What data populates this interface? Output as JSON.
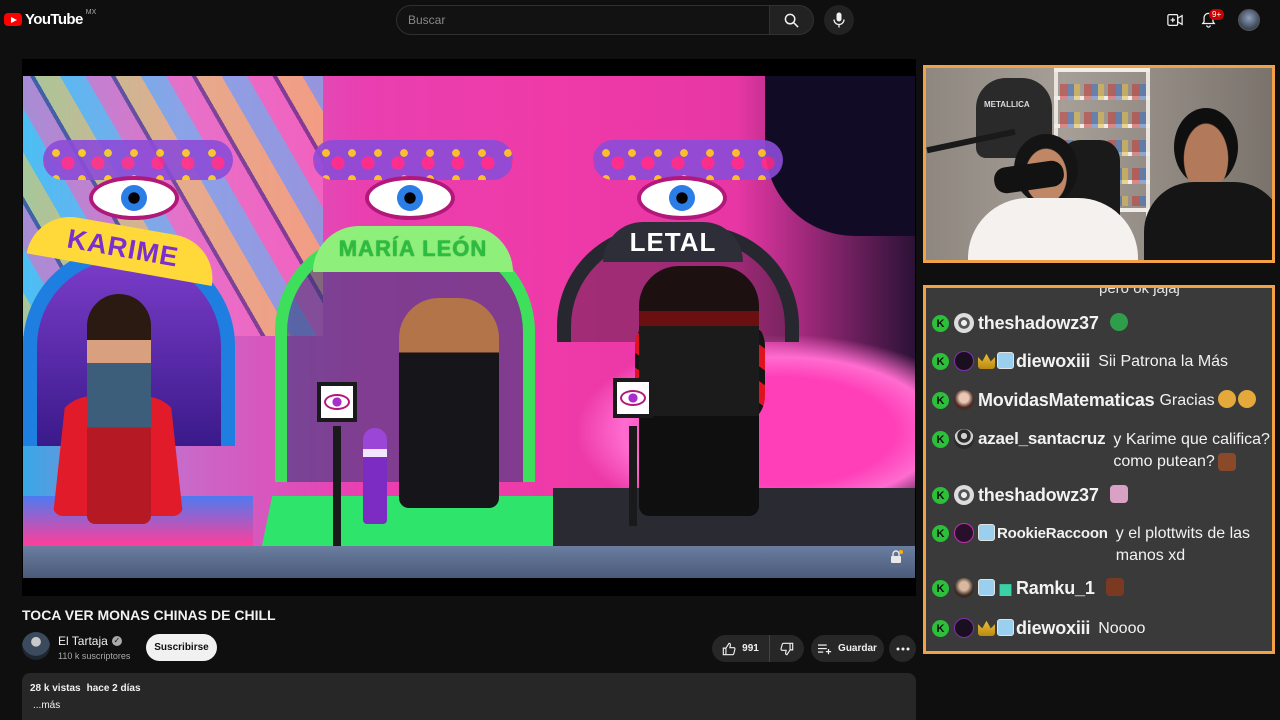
{
  "header": {
    "logo_text": "YouTube",
    "country_code": "MX",
    "search_placeholder": "Buscar",
    "notification_count": "9+"
  },
  "video": {
    "title": "TOCA VER MONAS CHINAS DE CHILL",
    "scene_labels": [
      "KARIME",
      "MARÍA LEÓN",
      "LETAL"
    ]
  },
  "channel": {
    "name": "El Tartaja",
    "subscribers": "110 k suscriptores",
    "subscribe_label": "Suscribirse"
  },
  "actions": {
    "like_count": "991",
    "save_label": "Guardar"
  },
  "description": {
    "views": "28 k vistas",
    "date": "hace 2 días",
    "more_label": "...más"
  },
  "webcam": {
    "jacket_text": "METALLICA"
  },
  "chat": {
    "cut_off_text": "pero ok jajaj",
    "messages": [
      {
        "user": "theshadowz37",
        "text": ""
      },
      {
        "user": "diewoxiii",
        "text": "Sii Patrona la Más"
      },
      {
        "user": "MovidasMatematicas",
        "text": "Gracias"
      },
      {
        "user": "azael_santacruz",
        "text": "y Karime que califica? como putean?"
      },
      {
        "user": "theshadowz37",
        "text": ""
      },
      {
        "user": "RookieRaccoon",
        "text": "y el plottwits de las manos xd"
      },
      {
        "user": "Ramku_1",
        "text": ""
      },
      {
        "user": "diewoxiii",
        "text": "Noooo"
      }
    ]
  },
  "colors": {
    "accent_border": "#f2a146",
    "kick_green": "#2bbf3a",
    "youtube_red": "#ff0000"
  }
}
